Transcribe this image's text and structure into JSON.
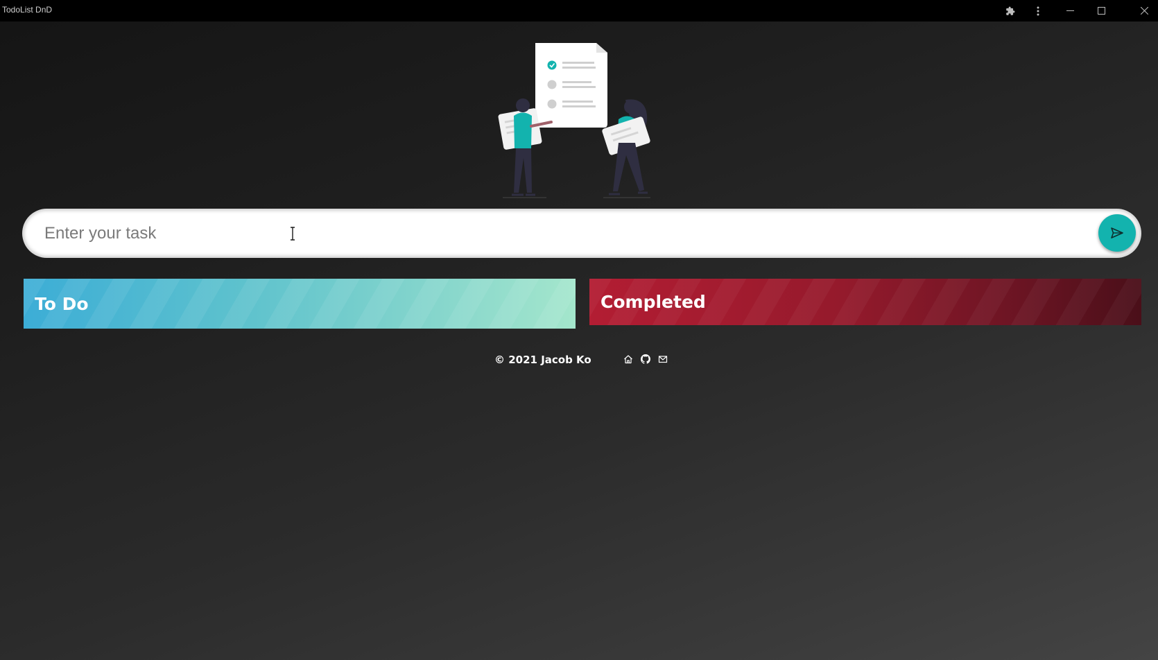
{
  "window": {
    "title": "TodoList DnD",
    "controls": [
      "extensions-icon",
      "more-vert-icon",
      "minimize-icon",
      "maximize-icon",
      "close-icon"
    ]
  },
  "illustration": {
    "icon": "people-holding-checklist-illustration",
    "accent_color": "#13b3ae"
  },
  "task_input": {
    "value": "",
    "placeholder": "Enter your task",
    "submit_icon": "send-icon",
    "submit_color": "#13b3ae"
  },
  "columns": [
    {
      "title": "To Do",
      "colors": [
        "#3cadd6",
        "#a4e6cc"
      ],
      "tasks": []
    },
    {
      "title": "Completed",
      "colors": [
        "#b31d33",
        "#4a0f19"
      ],
      "tasks": []
    }
  ],
  "footer": {
    "copyright": "© 2021 Jacob Ko",
    "links": [
      "home-icon",
      "github-icon",
      "mail-icon"
    ]
  }
}
